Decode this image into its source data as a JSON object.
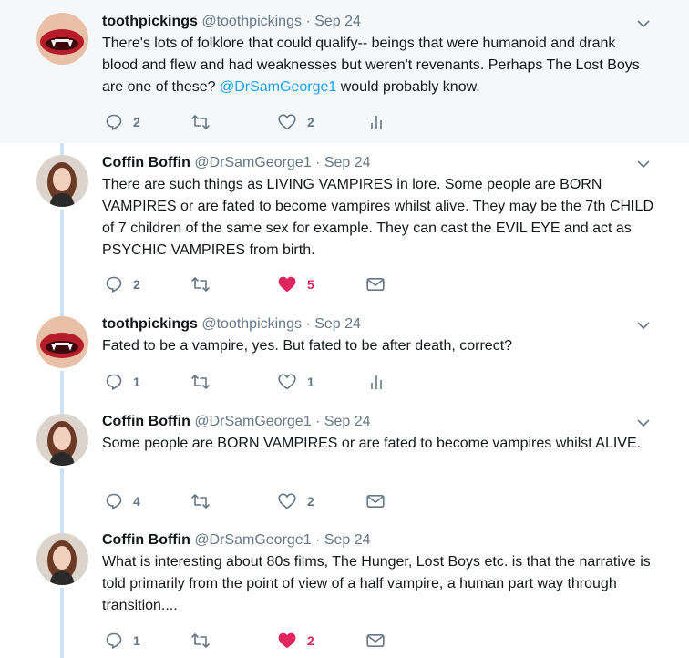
{
  "tweets": [
    {
      "name": "toothpickings",
      "handle": "@toothpickings",
      "separator": "·",
      "date": "Sep 24",
      "text_parts": [
        "There's lots of folklore that could qualify-- beings that were humanoid and drank blood and flew and had weaknesses but weren't revenants.  Perhaps The Lost Boys are one of these? ",
        "@DrSamGeorge1",
        " would probably know."
      ],
      "avatar": "lips-avatar",
      "replies": "2",
      "likes": "2",
      "liked": false,
      "extra_icon": "analytics-icon"
    },
    {
      "name": "Coffin Boffin",
      "handle": "@DrSamGeorge1",
      "separator": "·",
      "date": "Sep 24",
      "text": "There are such things as LIVING VAMPIRES in lore. Some people are BORN VAMPIRES or are fated to become vampires whilst alive. They may be the 7th CHILD of 7 children of the same sex for example. They can cast the EVIL EYE and act as PSYCHIC VAMPIRES from birth.",
      "avatar": "woman-avatar",
      "replies": "2",
      "likes": "5",
      "liked": true,
      "extra_icon": "message-icon"
    },
    {
      "name": "toothpickings",
      "handle": "@toothpickings",
      "separator": "·",
      "date": "Sep 24",
      "text": "Fated to be a vampire, yes.  But fated to be after death, correct?",
      "avatar": "lips-avatar",
      "replies": "1",
      "likes": "1",
      "liked": false,
      "extra_icon": "analytics-icon"
    },
    {
      "name": "Coffin Boffin",
      "handle": "@DrSamGeorge1",
      "separator": "·",
      "date": "Sep 24",
      "text": "Some people are BORN VAMPIRES or are fated to become vampires whilst ALIVE.",
      "avatar": "woman-avatar",
      "replies": "4",
      "likes": "2",
      "liked": false,
      "extra_icon": "message-icon"
    },
    {
      "name": "Coffin Boffin",
      "handle": "@DrSamGeorge1",
      "separator": "·",
      "date": "Sep 24",
      "text": "What is interesting about 80s films, The Hunger, Lost Boys etc. is that the narrative is told primarily from the point of view of a half vampire, a human part way through transition....",
      "avatar": "woman-avatar",
      "replies": "1",
      "likes": "2",
      "liked": true,
      "extra_icon": "message-icon"
    }
  ],
  "colors": {
    "accent": "#1da1f2",
    "muted": "#657786",
    "like": "#e0245e",
    "thread": "#cce3f7",
    "highlight_bg": "#f5f8fa"
  }
}
